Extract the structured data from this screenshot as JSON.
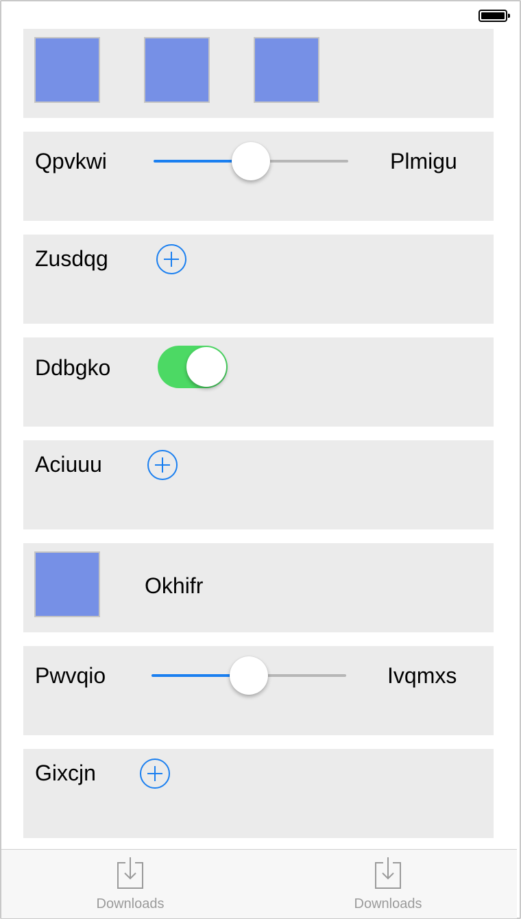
{
  "rows": {
    "images": {
      "count": 3
    },
    "slider1": {
      "min_label": "Qpvkwi",
      "max_label": "Plmigu",
      "value": 0.5
    },
    "add1": {
      "label": "Zusdqg"
    },
    "toggle1": {
      "label": "Ddbgko",
      "on": true
    },
    "add2": {
      "label": "Aciuuu"
    },
    "image_text": {
      "label": "Okhifr"
    },
    "slider2": {
      "min_label": "Pwvqio",
      "max_label": "Ivqmxs",
      "value": 0.5
    },
    "add3": {
      "label": "Gixcjn"
    }
  },
  "tab_bar": {
    "items": [
      {
        "label": "Downloads",
        "icon": "download-icon"
      },
      {
        "label": "Downloads",
        "icon": "download-icon"
      }
    ]
  },
  "colors": {
    "accent": "#1a7ff0",
    "toggle_on": "#4cd964",
    "image_placeholder": "#7690e6",
    "row_background": "#ebebeb"
  }
}
